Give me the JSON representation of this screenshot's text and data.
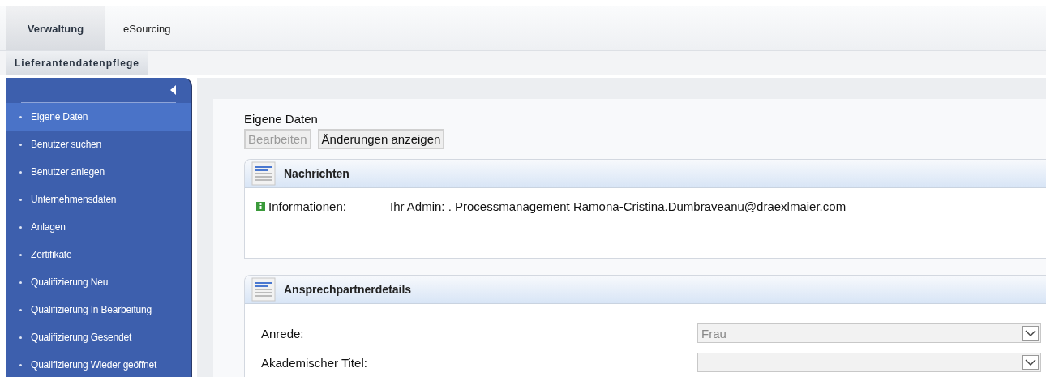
{
  "tabs": [
    {
      "label": "Verwaltung",
      "selected": true
    },
    {
      "label": "eSourcing",
      "selected": false
    }
  ],
  "subtabs": [
    {
      "label": "Lieferantendatenpflege",
      "selected": true
    }
  ],
  "sidebar": {
    "items": [
      {
        "label": "Eigene Daten",
        "selected": true
      },
      {
        "label": "Benutzer suchen",
        "selected": false
      },
      {
        "label": "Benutzer anlegen",
        "selected": false
      },
      {
        "label": "Unternehmensdaten",
        "selected": false
      },
      {
        "label": "Anlagen",
        "selected": false
      },
      {
        "label": "Zertifikate",
        "selected": false
      },
      {
        "label": "Qualifizierung Neu",
        "selected": false
      },
      {
        "label": "Qualifizierung In Bearbeitung",
        "selected": false
      },
      {
        "label": "Qualifizierung Gesendet",
        "selected": false
      },
      {
        "label": "Qualifizierung Wieder geöffnet",
        "selected": false
      }
    ]
  },
  "page_title": "Eigene Daten",
  "buttons": [
    {
      "label": "Bearbeiten",
      "disabled": true
    },
    {
      "label": "Änderungen anzeigen",
      "disabled": false
    }
  ],
  "messages": {
    "title": "Nachrichten",
    "items": [
      {
        "label": "Informationen:",
        "text": "Ihr Admin: . Processmanagement Ramona-Cristina.Dumbraveanu@draexlmaier.com"
      }
    ]
  },
  "contact": {
    "title": "Ansprechpartnerdetails",
    "fields": [
      {
        "label": "Anrede:",
        "value": "Frau",
        "disabled": true
      },
      {
        "label": "Akademischer Titel:",
        "disabled": true
      }
    ]
  }
}
